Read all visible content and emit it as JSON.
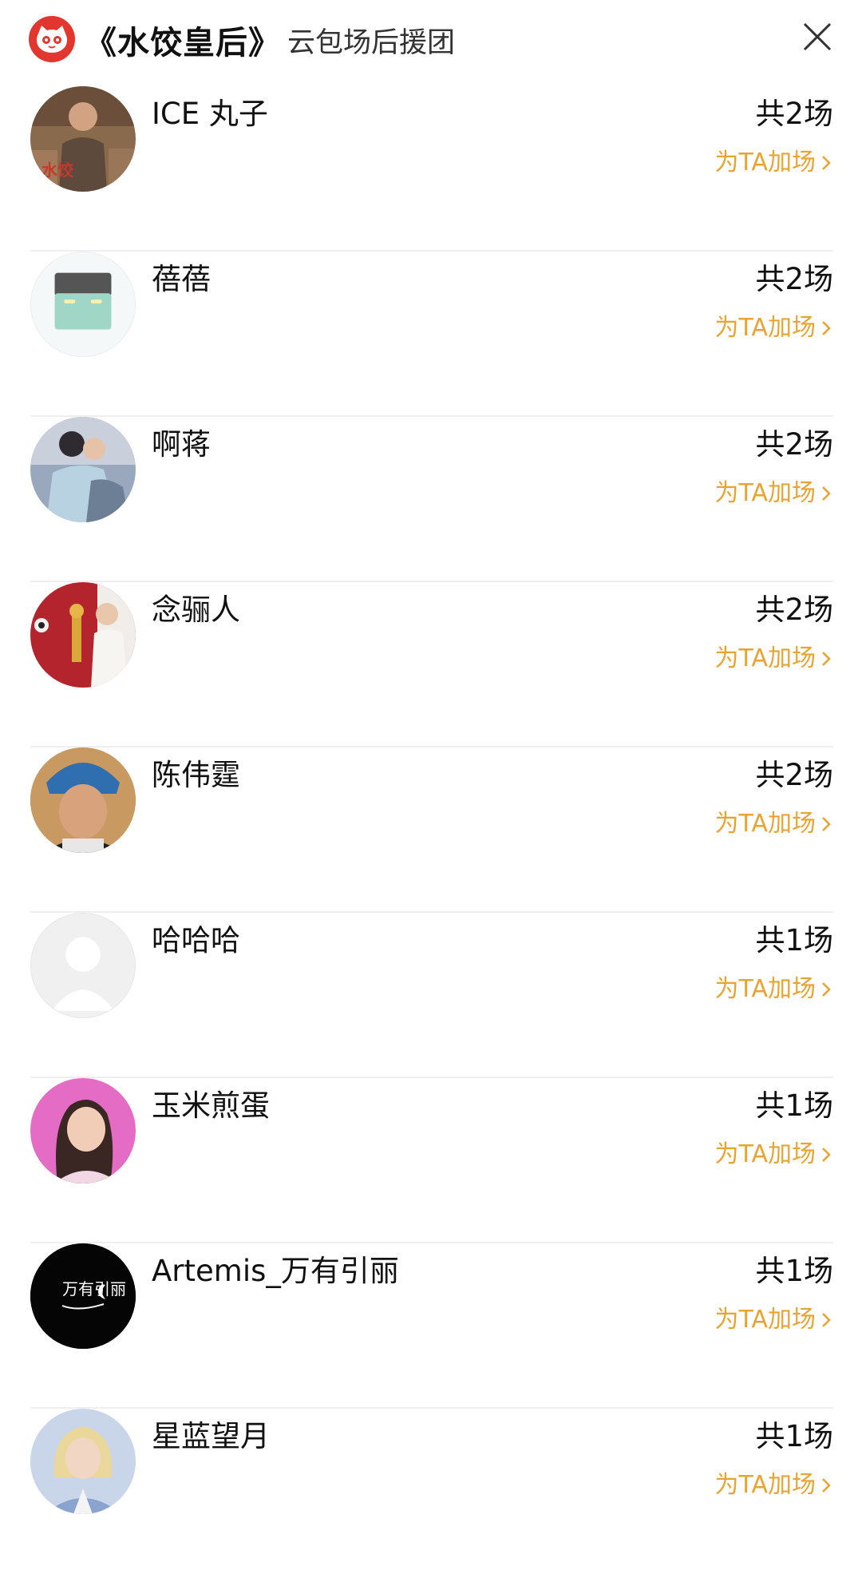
{
  "header": {
    "title": "《水饺皇后》",
    "subtitle": "云包场后援团",
    "logo_icon": "cat-logo-icon",
    "close_icon": "close-icon"
  },
  "colors": {
    "accent": "#e8a433",
    "logo_red": "#e1372f",
    "divider": "#efefef"
  },
  "supporters": [
    {
      "name": "ICE 丸子",
      "count": "共2场",
      "action": "为TA加场",
      "avatar": "movie-poster-avatar"
    },
    {
      "name": "蓓蓓",
      "count": "共2场",
      "action": "为TA加场",
      "avatar": "robot-avatar"
    },
    {
      "name": "啊蒋",
      "count": "共2场",
      "action": "为TA加场",
      "avatar": "photo-avatar"
    },
    {
      "name": "念骊人",
      "count": "共2场",
      "action": "为TA加场",
      "avatar": "award-photo-avatar"
    },
    {
      "name": "陈伟霆",
      "count": "共2场",
      "action": "为TA加场",
      "avatar": "portrait-avatar"
    },
    {
      "name": "哈哈哈",
      "count": "共1场",
      "action": "为TA加场",
      "avatar": "default-avatar"
    },
    {
      "name": "玉米煎蛋",
      "count": "共1场",
      "action": "为TA加场",
      "avatar": "pink-portrait-avatar"
    },
    {
      "name": "Artemis_万有引丽",
      "count": "共1场",
      "action": "为TA加场",
      "avatar": "logo-avatar"
    },
    {
      "name": "星蓝望月",
      "count": "共1场",
      "action": "为TA加场",
      "avatar": "blue-portrait-avatar"
    }
  ],
  "logo_avatar_text": "万有引丽"
}
